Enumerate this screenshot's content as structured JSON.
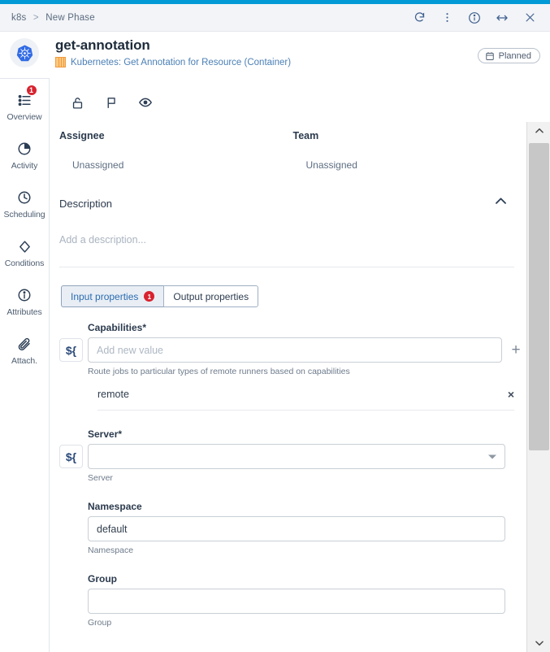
{
  "window": {
    "breadcrumb_root": "k8s",
    "breadcrumb_sep": ">",
    "breadcrumb_current": "New Phase",
    "actions": [
      {
        "name": "refresh-icon",
        "label": "Refresh"
      },
      {
        "name": "more-vertical-icon",
        "label": "More"
      },
      {
        "name": "info-icon",
        "label": "Info"
      },
      {
        "name": "resize-horizontal-icon",
        "label": "Resize"
      },
      {
        "name": "close-icon",
        "label": "Close"
      }
    ]
  },
  "header": {
    "title": "get-annotation",
    "subtitle": "Kubernetes: Get Annotation for Resource (Container)",
    "avatar_icon": "kubernetes-logo",
    "status_label": "Planned",
    "status_icon": "calendar-icon"
  },
  "sidebar": {
    "items": [
      {
        "label": "Overview",
        "icon": "list-icon",
        "badge": "1",
        "active": true
      },
      {
        "label": "Activity",
        "icon": "pie-clock-icon",
        "badge": null,
        "active": false
      },
      {
        "label": "Scheduling",
        "icon": "clock-icon",
        "badge": null,
        "active": false
      },
      {
        "label": "Conditions",
        "icon": "diamond-icon",
        "badge": null,
        "active": false
      },
      {
        "label": "Attributes",
        "icon": "info-circle-icon",
        "badge": null,
        "active": false
      },
      {
        "label": "Attach.",
        "icon": "paperclip-icon",
        "badge": null,
        "active": false
      }
    ]
  },
  "toolbar": {
    "icons": [
      {
        "name": "unlock-icon",
        "label": "Lock"
      },
      {
        "name": "flag-icon",
        "label": "Flag"
      },
      {
        "name": "eye-icon",
        "label": "Watch"
      }
    ]
  },
  "meta": {
    "assignee_label": "Assignee",
    "assignee_value": "Unassigned",
    "team_label": "Team",
    "team_value": "Unassigned"
  },
  "description": {
    "title": "Description",
    "placeholder": "Add a description...",
    "collapse_icon": "chevron-up-icon"
  },
  "tabs": [
    {
      "label": "Input properties",
      "badge": "1",
      "active": true
    },
    {
      "label": "Output properties",
      "badge": null,
      "active": false
    }
  ],
  "form": {
    "expr_button_label": "${",
    "add_icon": "plus-icon",
    "fields": [
      {
        "label": "Capabilities",
        "required": true,
        "required_mark": "*",
        "type": "multivalue",
        "value": "",
        "placeholder": "Add new value",
        "help": "Route jobs to particular types of remote runners based on capabilities",
        "has_expr": true,
        "has_add": true,
        "chips": [
          {
            "name": "remote",
            "remove_icon": "close-icon",
            "remove_label": "×"
          }
        ]
      },
      {
        "label": "Server",
        "required": true,
        "required_mark": "*",
        "type": "select",
        "value": "",
        "placeholder": "",
        "help": "Server",
        "has_expr": true,
        "has_add": false,
        "chips": []
      },
      {
        "label": "Namespace",
        "required": false,
        "required_mark": "",
        "type": "text",
        "value": "default",
        "placeholder": "",
        "help": "Namespace",
        "has_expr": false,
        "has_add": false,
        "chips": []
      },
      {
        "label": "Group",
        "required": false,
        "required_mark": "",
        "type": "text",
        "value": "",
        "placeholder": "",
        "help": "Group",
        "has_expr": false,
        "has_add": false,
        "chips": []
      }
    ]
  },
  "scrollbar": {
    "up_icon": "chevron-up-icon",
    "down_icon": "chevron-down-icon"
  },
  "colors": {
    "accent": "#029ad6",
    "badge_red": "#d8232f",
    "link_blue": "#2b6cb0",
    "k8s_blue": "#326ce5",
    "orange": "#f09a3e"
  }
}
